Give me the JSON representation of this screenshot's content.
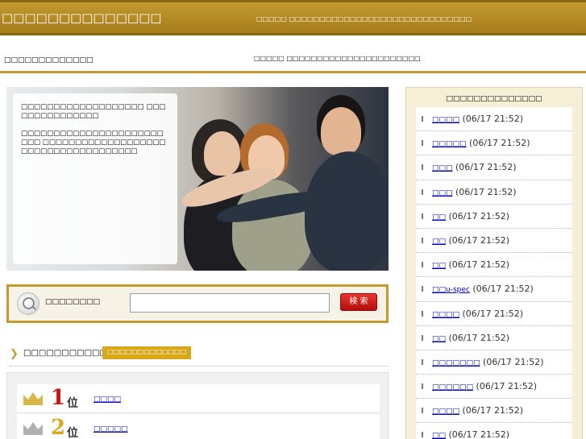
{
  "header": {
    "title": "□□□□□□□□□□□□□□",
    "description": "□□□□□ □□□□□□□□□□□□□□□□□□□□□□□□□□□□□□"
  },
  "subbar": {
    "left_text": "□□□□□□□□□□□□□",
    "right_text": "□□□□□ □□□□□□□□□□□□□□□□□□□□□□"
  },
  "hero": {
    "text1": "□□□□□□□□□□□□□□□□□□□ □□□□□□□□□□□□□□□",
    "text2": "□□□□□□□□□□□□□□□□□□□□□□□□□ □□□□□□□□□□□□□□□□□□□□□□□□□□□□□□□□□□□□□"
  },
  "search": {
    "label": "□□□□□□□□",
    "placeholder": "",
    "button_label": "検 索"
  },
  "ranking": {
    "title": "□□□□□□□□□□□□□□",
    "badge": "□□□□□□□□□□□□□",
    "items": [
      {
        "rank": "1",
        "unit": "位",
        "label": "□□□□",
        "crown_color": "#d9b64a",
        "num_color": "#cc1111"
      },
      {
        "rank": "2",
        "unit": "位",
        "label": "□□□□□",
        "crown_color": "#b0b0b0",
        "num_color": "#d9a81a"
      }
    ]
  },
  "sidebar": {
    "title": "□□□□□□□□□□□□□□",
    "items": [
      {
        "label": "□□□□",
        "date": "(06/17 21:52)"
      },
      {
        "label": "□□□□□",
        "date": "(06/17 21:52)"
      },
      {
        "label": "□□□",
        "date": "(06/17 21:52)"
      },
      {
        "label": "□□□",
        "date": "(06/17 21:52)"
      },
      {
        "label": "□□",
        "date": "(06/17 21:52)"
      },
      {
        "label": "□□",
        "date": "(06/17 21:52)"
      },
      {
        "label": "□□",
        "date": "(06/17 21:52)"
      },
      {
        "label": "□□u-spec",
        "date": "(06/17 21:52)"
      },
      {
        "label": "□□□□",
        "date": "(06/17 21:52)"
      },
      {
        "label": "□□",
        "date": "(06/17 21:52)"
      },
      {
        "label": "□□□□□□□",
        "date": "(06/17 21:52)"
      },
      {
        "label": "□□□□□□",
        "date": "(06/17 21:52)"
      },
      {
        "label": "□□□□",
        "date": "(06/17 21:52)"
      },
      {
        "label": "□□",
        "date": "(06/17 21:52)"
      }
    ]
  },
  "colors": {
    "brand_gold": "#c29a2e",
    "sidebar_bg": "#f6efd8",
    "link": "#0000cc",
    "search_button": "#cc1111"
  }
}
